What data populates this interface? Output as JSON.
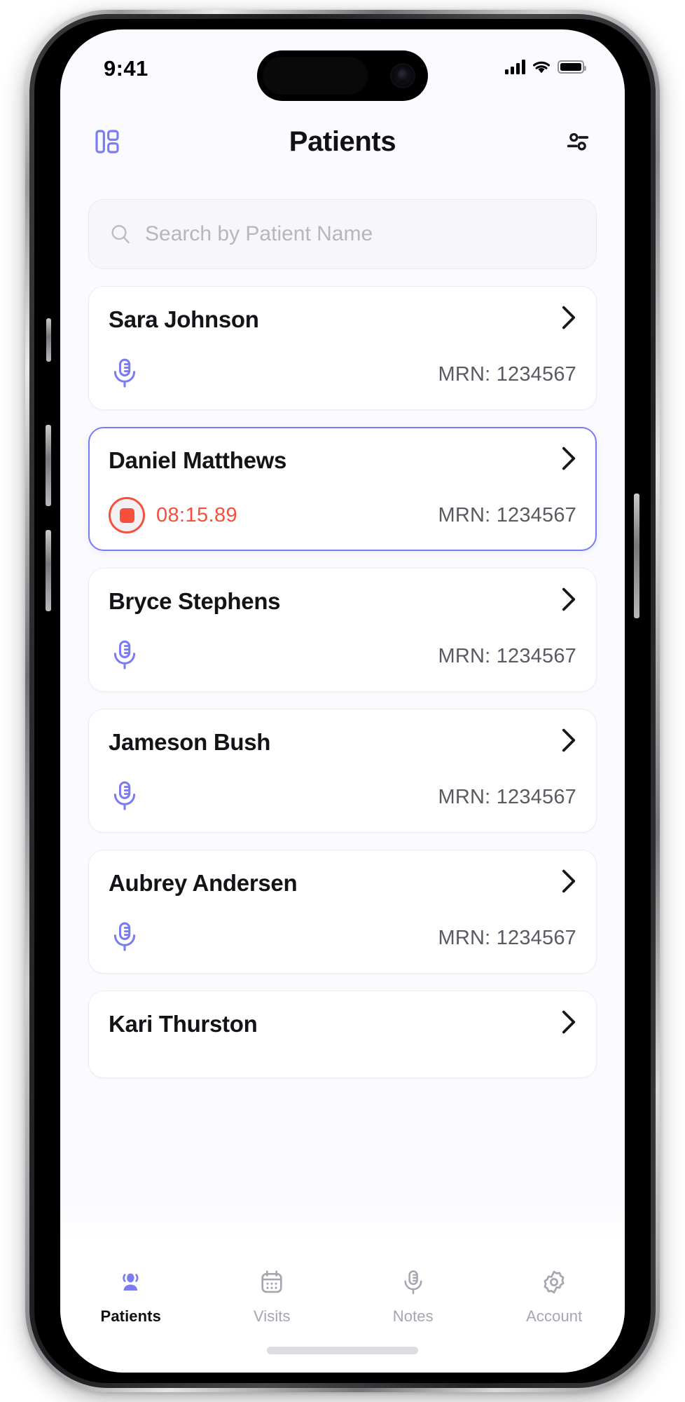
{
  "status_bar": {
    "time": "9:41",
    "cellular_icon": "cellular-signal-icon",
    "wifi_icon": "wifi-icon",
    "battery_icon": "battery-full-icon"
  },
  "header": {
    "left_icon": "dashboard-layout-icon",
    "title": "Patients",
    "right_icon": "filter-sliders-icon"
  },
  "search": {
    "icon": "search-icon",
    "placeholder": "Search by Patient Name",
    "value": ""
  },
  "theme": {
    "accent": "#7B7BF2",
    "recording_red": "#F4503C",
    "text_primary": "#141418",
    "text_muted": "#5A5A62",
    "card_border": "#EDEDF1",
    "screen_bg": "#FAFAFF"
  },
  "patients": [
    {
      "name": "Sara Johnson",
      "mrn": "MRN: 1234567",
      "status": "idle",
      "status_icon": "microphone-icon",
      "chevron_icon": "chevron-right-icon",
      "selected": false
    },
    {
      "name": "Daniel Matthews",
      "mrn": "MRN: 1234567",
      "status": "recording",
      "status_icon": "stop-recording-icon",
      "timer": "08:15.89",
      "chevron_icon": "chevron-right-icon",
      "selected": true
    },
    {
      "name": "Bryce Stephens",
      "mrn": "MRN: 1234567",
      "status": "idle",
      "status_icon": "microphone-icon",
      "chevron_icon": "chevron-right-icon",
      "selected": false
    },
    {
      "name": "Jameson Bush",
      "mrn": "MRN: 1234567",
      "status": "idle",
      "status_icon": "microphone-icon",
      "chevron_icon": "chevron-right-icon",
      "selected": false
    },
    {
      "name": "Aubrey Andersen",
      "mrn": "MRN: 1234567",
      "status": "idle",
      "status_icon": "microphone-icon",
      "chevron_icon": "chevron-right-icon",
      "selected": false
    },
    {
      "name": "Kari Thurston",
      "mrn": "",
      "status": "idle",
      "status_icon": "microphone-icon",
      "chevron_icon": "chevron-right-icon",
      "selected": false,
      "partial": true
    }
  ],
  "tabbar": {
    "items": [
      {
        "label": "Patients",
        "icon": "people-group-icon",
        "active": true
      },
      {
        "label": "Visits",
        "icon": "calendar-icon",
        "active": false
      },
      {
        "label": "Notes",
        "icon": "microphone-icon",
        "active": false
      },
      {
        "label": "Account",
        "icon": "gear-icon",
        "active": false
      }
    ]
  }
}
